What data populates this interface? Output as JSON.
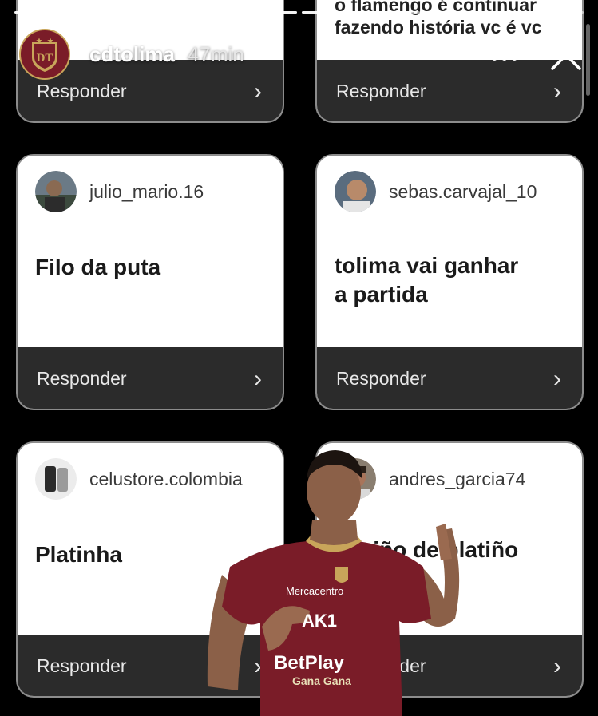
{
  "story": {
    "username": "cdtolima",
    "time_ago": "47min",
    "segments_total": 14,
    "segments_done": 8
  },
  "cards": [
    {
      "username": "",
      "message": "",
      "button": "Responder"
    },
    {
      "username": "",
      "message": "o flamengo é continuar\nfazendo história vc é vc",
      "button": "Responder"
    },
    {
      "username": "julio_mario.16",
      "message": "Filo da puta",
      "button": "Responder"
    },
    {
      "username": "sebas.carvajal_10",
      "message": "tolima vai ganhar\na partida",
      "button": "Responder"
    },
    {
      "username": "celustore.colombia",
      "message": "Platinha",
      "button": "Responder"
    },
    {
      "username": "andres_garcia74",
      "message": "desiño de platiño\n👍👍👍",
      "button": "Responder"
    }
  ],
  "player": {
    "sponsor_main": "BetPlay",
    "sponsor_sub": "Gana Gana",
    "sponsor_chest": "Mercacentro",
    "sponsor_logo": "AK1"
  },
  "colors": {
    "team_primary": "#7a1c28",
    "team_gold": "#c8a55a",
    "footer": "#2b2b2b"
  }
}
